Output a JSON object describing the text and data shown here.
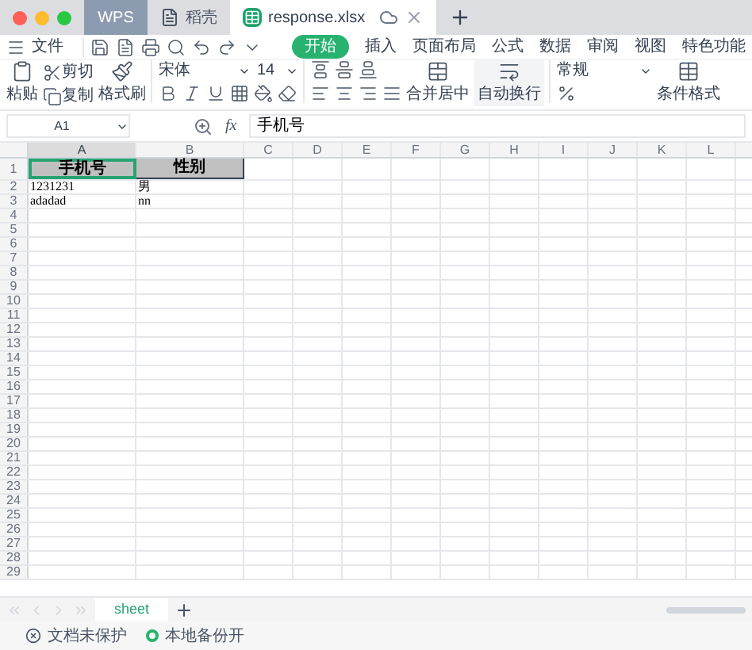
{
  "title_tabs": [
    {
      "label": "WPS",
      "kind": "home",
      "selected": false
    },
    {
      "label": "稻壳",
      "kind": "docer",
      "selected": false
    },
    {
      "label": "response.xlsx",
      "kind": "sheet",
      "selected": true
    }
  ],
  "menu": {
    "file": "文件",
    "tabs": [
      {
        "label": "开始",
        "selected": true
      },
      {
        "label": "插入",
        "selected": false
      },
      {
        "label": "页面布局",
        "selected": false
      },
      {
        "label": "公式",
        "selected": false
      },
      {
        "label": "数据",
        "selected": false
      },
      {
        "label": "审阅",
        "selected": false
      },
      {
        "label": "视图",
        "selected": false
      },
      {
        "label": "特色功能",
        "selected": false
      }
    ]
  },
  "toolbar": {
    "paste": "粘贴",
    "cut": "剪切",
    "copy": "复制",
    "format_painter": "格式刷",
    "font": "宋体",
    "size": "14",
    "merge": "合并居中",
    "wrap": "自动换行",
    "number_format": "常规",
    "conditional": "条件格式"
  },
  "formula_bar": {
    "cell": "A1",
    "fx": "fx",
    "value": "手机号"
  },
  "columns": [
    {
      "label": "A",
      "selected": true
    },
    {
      "label": "B",
      "selected": false
    },
    {
      "label": "C",
      "selected": false
    },
    {
      "label": "D",
      "selected": false
    },
    {
      "label": "E",
      "selected": false
    },
    {
      "label": "F",
      "selected": false
    },
    {
      "label": "G",
      "selected": false
    },
    {
      "label": "H",
      "selected": false
    },
    {
      "label": "I",
      "selected": false
    },
    {
      "label": "J",
      "selected": false
    },
    {
      "label": "K",
      "selected": false
    },
    {
      "label": "L",
      "selected": false
    }
  ],
  "rows": [
    {
      "number": "1",
      "header": true,
      "cells": [
        "手机号",
        "性别"
      ]
    },
    {
      "number": "2",
      "header": false,
      "cells": [
        "1231231",
        "男"
      ]
    },
    {
      "number": "3",
      "header": false,
      "cells": [
        "adadad",
        "nn"
      ]
    },
    {
      "number": "4",
      "header": false,
      "cells": []
    },
    {
      "number": "5",
      "header": false,
      "cells": []
    },
    {
      "number": "6",
      "header": false,
      "cells": []
    },
    {
      "number": "7",
      "header": false,
      "cells": []
    },
    {
      "number": "8",
      "header": false,
      "cells": []
    },
    {
      "number": "9",
      "header": false,
      "cells": []
    },
    {
      "number": "10",
      "header": false,
      "cells": []
    },
    {
      "number": "11",
      "header": false,
      "cells": []
    },
    {
      "number": "12",
      "header": false,
      "cells": []
    },
    {
      "number": "13",
      "header": false,
      "cells": []
    },
    {
      "number": "14",
      "header": false,
      "cells": []
    },
    {
      "number": "15",
      "header": false,
      "cells": []
    },
    {
      "number": "16",
      "header": false,
      "cells": []
    },
    {
      "number": "17",
      "header": false,
      "cells": []
    },
    {
      "number": "18",
      "header": false,
      "cells": []
    },
    {
      "number": "19",
      "header": false,
      "cells": []
    },
    {
      "number": "20",
      "header": false,
      "cells": []
    },
    {
      "number": "21",
      "header": false,
      "cells": []
    },
    {
      "number": "22",
      "header": false,
      "cells": []
    },
    {
      "number": "23",
      "header": false,
      "cells": []
    },
    {
      "number": "24",
      "header": false,
      "cells": []
    },
    {
      "number": "25",
      "header": false,
      "cells": []
    },
    {
      "number": "26",
      "header": false,
      "cells": []
    },
    {
      "number": "27",
      "header": false,
      "cells": []
    },
    {
      "number": "28",
      "header": false,
      "cells": []
    },
    {
      "number": "29",
      "header": false,
      "cells": []
    }
  ],
  "sheets": [
    {
      "label": "sheet",
      "selected": true
    }
  ],
  "status": {
    "protect": "文档未保护",
    "backup": "本地备份开"
  }
}
